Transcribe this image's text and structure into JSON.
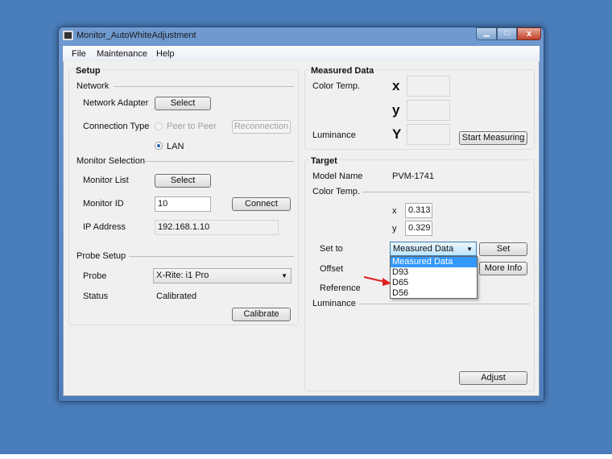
{
  "window": {
    "title": "Monitor_AutoWhiteAdjustment"
  },
  "menu": [
    "File",
    "Maintenance",
    "Help"
  ],
  "setup": {
    "title": "Setup",
    "network": {
      "title": "Network",
      "adapter_label": "Network Adapter",
      "adapter_button": "Select",
      "conn_type_label": "Connection Type",
      "option_p2p": "Peer to Peer",
      "option_lan": "LAN",
      "selected": "LAN",
      "reconnection_button": "Reconnection"
    },
    "monitor": {
      "title": "Monitor Selection",
      "list_label": "Monitor List",
      "list_button": "Select",
      "id_label": "Monitor ID",
      "id_value": "10",
      "connect_button": "Connect",
      "ip_label": "IP Address",
      "ip_value": "192.168.1.10"
    },
    "probe": {
      "title": "Probe Setup",
      "probe_label": "Probe",
      "probe_value": "X-Rite: i1 Pro",
      "status_label": "Status",
      "status_value": "Calibrated",
      "calibrate_button": "Calibrate"
    }
  },
  "measured": {
    "title": "Measured Data",
    "color_temp_label": "Color Temp.",
    "x_label": "x",
    "y_label": "y",
    "luminance_label": "Luminance",
    "Y_label": "Y",
    "start_button": "Start Measuring"
  },
  "target": {
    "title": "Target",
    "model_label": "Model Name",
    "model_value": "PVM-1741",
    "color_temp_label": "Color Temp.",
    "x_label": "x",
    "x_value": "0.313",
    "y_label": "y",
    "y_value": "0.329",
    "set_to_label": "Set to",
    "set_to_value": "Measured Data",
    "set_button": "Set",
    "offset_label": "Offset",
    "more_info_button": "More Info",
    "reference_label": "Reference",
    "luminance_label": "Luminance",
    "adjust_button": "Adjust",
    "dropdown_options": [
      "Measured Data",
      "D93",
      "D65",
      "D56"
    ],
    "highlighted_option": "Measured Data"
  },
  "colors": {
    "highlight": "#3399ff",
    "annotation_arrow": "#e02020"
  }
}
